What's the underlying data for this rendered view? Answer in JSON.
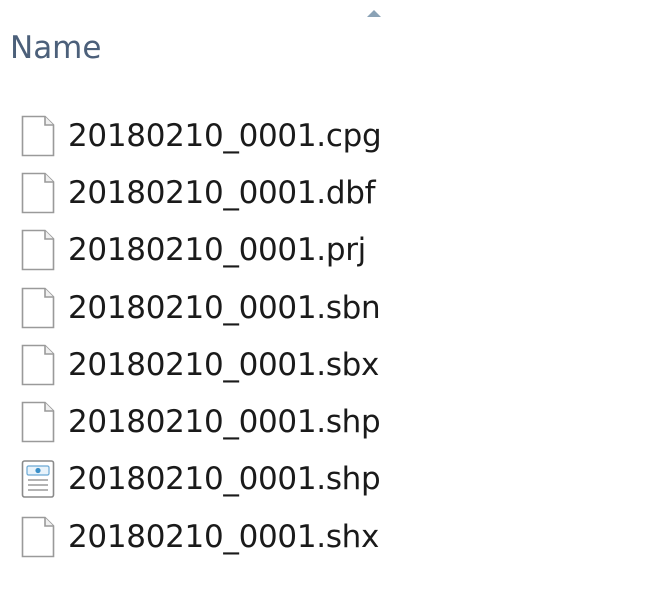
{
  "header": {
    "name_column_label": "Name",
    "sort_indicator": "sort-ascending-arrow"
  },
  "files": [
    {
      "name": "20180210_0001.cpg",
      "icon": "blank-file-icon"
    },
    {
      "name": "20180210_0001.dbf",
      "icon": "blank-file-icon"
    },
    {
      "name": "20180210_0001.prj",
      "icon": "blank-file-icon"
    },
    {
      "name": "20180210_0001.sbn",
      "icon": "blank-file-icon"
    },
    {
      "name": "20180210_0001.sbx",
      "icon": "blank-file-icon"
    },
    {
      "name": "20180210_0001.shp",
      "icon": "blank-file-icon"
    },
    {
      "name": "20180210_0001.shp",
      "icon": "xml-document-icon"
    },
    {
      "name": "20180210_0001.shx",
      "icon": "blank-file-icon"
    }
  ],
  "colors": {
    "header_text": "#4c607a",
    "sort_arrow": "#8aa2b6",
    "file_text": "#1a1a1a",
    "icon_outline": "#9a9a9a",
    "xml_icon_accent": "#3a8fc8"
  }
}
